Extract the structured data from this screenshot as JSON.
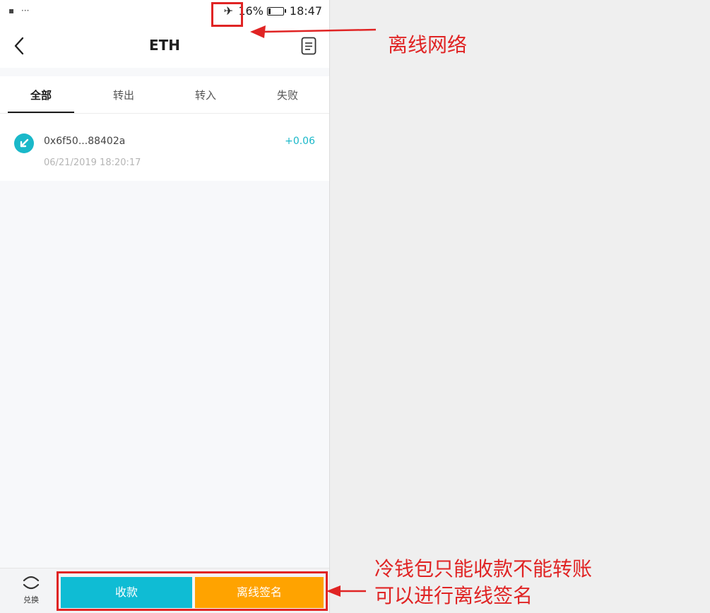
{
  "statusbar": {
    "left_icons": [
      "▪",
      "···"
    ],
    "airplane_icon": "✈",
    "battery_pct": "16%",
    "battery_level": 0.16,
    "time": "18:47"
  },
  "header": {
    "title": "ETH"
  },
  "tabs": [
    {
      "label": "全部",
      "active": true
    },
    {
      "label": "转出"
    },
    {
      "label": "转入"
    },
    {
      "label": "失败"
    }
  ],
  "transactions": [
    {
      "address": "0x6f50...88402a",
      "amount": "+0.06",
      "time": "06/21/2019 18:20:17"
    }
  ],
  "bottom": {
    "exchange_label": "兑换",
    "receive_label": "收款",
    "sign_label": "离线签名"
  },
  "annotations": {
    "offline_note": "离线网络",
    "cold_wallet_note_line1": "冷钱包只能收款不能转账",
    "cold_wallet_note_line2": "可以进行离线签名"
  },
  "colors": {
    "annotation": "#e02424",
    "receive_button": "#0fbcd4",
    "sign_button": "#ffa300",
    "amount_positive": "#1ab8c9"
  }
}
